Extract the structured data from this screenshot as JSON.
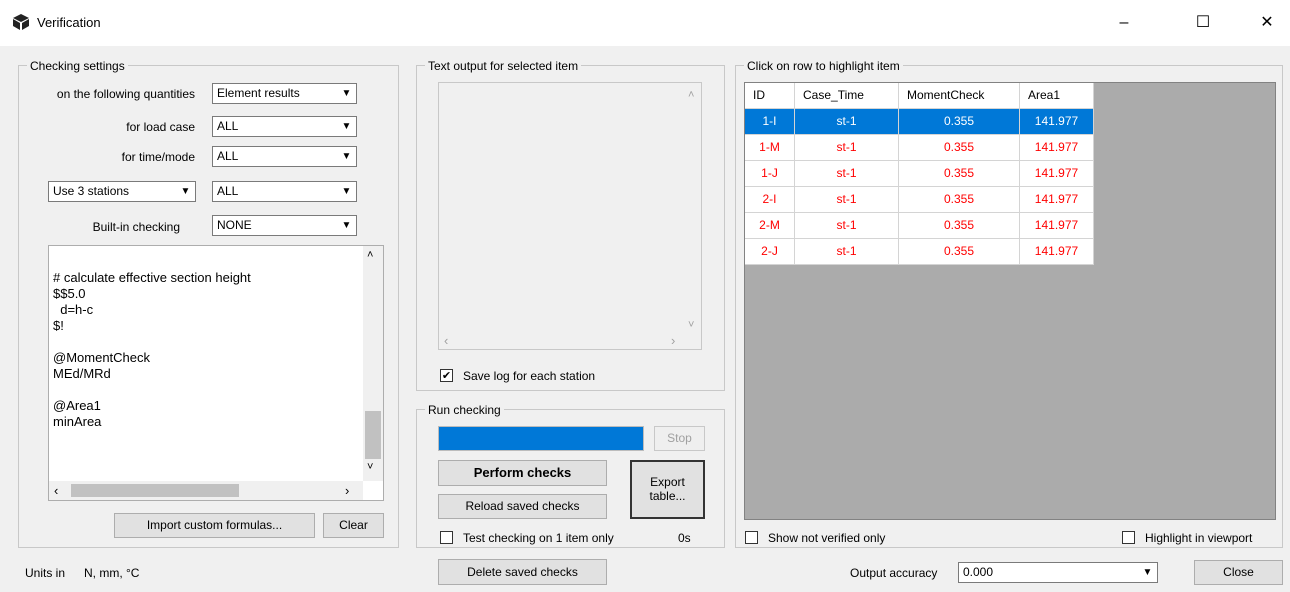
{
  "window": {
    "title": "Verification"
  },
  "titlebar": {
    "min": "–",
    "max": "☐",
    "close": "✕"
  },
  "settings": {
    "group_label": "Checking settings",
    "quantities_label": "on  the following quantities",
    "quantities_value": "Element results",
    "loadcase_label": "for load case",
    "loadcase_value": "ALL",
    "time_label": "for time/mode",
    "time_value": "ALL",
    "stations_value": "Use 3 stations",
    "stations_all": "ALL",
    "builtin_label": "Built-in checking",
    "builtin_value": "NONE",
    "formula_lines": [
      "",
      "# calculate effective section height",
      "$$5.0",
      "  d=h-c",
      "$!",
      "",
      "@MomentCheck",
      "MEd/MRd",
      "",
      "@Area1",
      "minArea"
    ],
    "import_btn": "Import custom formulas...",
    "clear_btn": "Clear"
  },
  "textout": {
    "group_label": "Text output for selected item",
    "save_log_label": "Save log for each station",
    "save_log_checked": "✔"
  },
  "run": {
    "group_label": "Run checking",
    "stop_btn": "Stop",
    "perform_btn": "Perform checks",
    "reload_btn": "Reload saved checks",
    "export_btn_1": "Export",
    "export_btn_2": "table...",
    "test_label": "Test checking on 1 item only",
    "time": "0s",
    "progress": 1.0
  },
  "table": {
    "group_label": "Click on row to highlight item",
    "columns": [
      "ID",
      "Case_Time",
      "MomentCheck",
      "Area1"
    ],
    "rows": [
      [
        "1-I",
        "st-1",
        "0.355",
        "141.977"
      ],
      [
        "1-M",
        "st-1",
        "0.355",
        "141.977"
      ],
      [
        "1-J",
        "st-1",
        "0.355",
        "141.977"
      ],
      [
        "2-I",
        "st-1",
        "0.355",
        "141.977"
      ],
      [
        "2-M",
        "st-1",
        "0.355",
        "141.977"
      ],
      [
        "2-J",
        "st-1",
        "0.355",
        "141.977"
      ]
    ],
    "selected_row": 0,
    "show_not_verified": "Show not verified only",
    "highlight_viewport": "Highlight in viewport"
  },
  "footer": {
    "units_label": "Units in",
    "units_value": "N, mm, °C",
    "delete_btn": "Delete saved checks",
    "accuracy_label": "Output accuracy",
    "accuracy_value": "0.000",
    "close_btn": "Close"
  },
  "colors": {
    "accent": "#0078d7",
    "fail": "#ff0000",
    "grid_bg": "#ababab"
  }
}
